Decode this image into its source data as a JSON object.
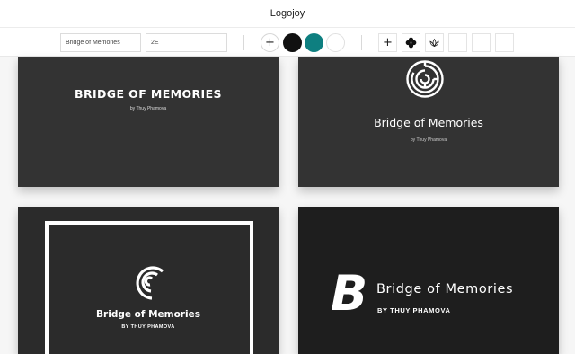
{
  "app": {
    "title": "Logojoy"
  },
  "toolbar": {
    "company_name_value": "Bridge of Memories",
    "slogan_value": "2E",
    "add_color_label": "+",
    "color_swatches": [
      {
        "name": "black",
        "color": "#111111"
      },
      {
        "name": "teal",
        "color": "#0e7f80"
      },
      {
        "name": "white",
        "color": "#ffffff"
      }
    ],
    "add_symbol_label": "+",
    "symbol_icons": [
      "clover-icon",
      "lotus-icon"
    ],
    "empty_symbol_slots": 3
  },
  "logos": [
    {
      "name": "BRIDGE OF MEMORIES",
      "tagline": "by Thuy Phamova",
      "icon": "none"
    },
    {
      "name": "Bridge of Memories",
      "tagline": "by Thuy Phamova",
      "icon": "maze-circle-icon"
    },
    {
      "name": "Bridge of Memories",
      "tagline": "BY THUY PHAMOVA",
      "icon": "concentric-arcs-icon"
    },
    {
      "name": "Bridge of Memories",
      "tagline": "BY THUY PHAMOVA",
      "icon": "letter-b-icon",
      "icon_text": "B"
    }
  ]
}
